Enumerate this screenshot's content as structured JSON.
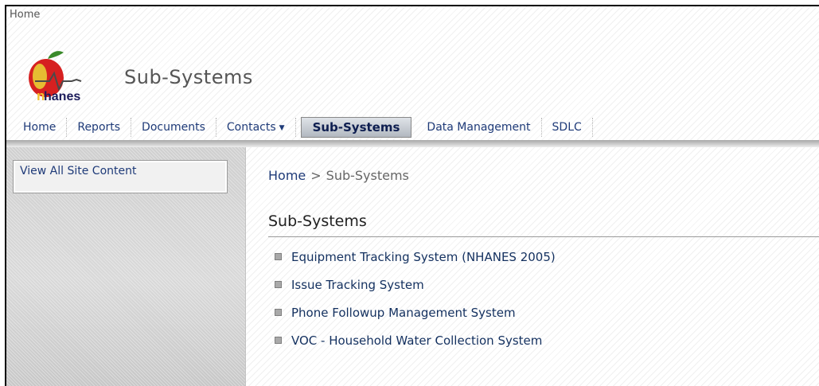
{
  "top_breadcrumb": "Home",
  "logo": {
    "text": "hanes",
    "first_letter": "n"
  },
  "site_title": "Sub-Systems",
  "topnav": [
    {
      "label": "Home",
      "active": false
    },
    {
      "label": "Reports",
      "active": false
    },
    {
      "label": "Documents",
      "active": false
    },
    {
      "label": "Contacts",
      "active": false,
      "dropdown": true
    },
    {
      "label": "Sub-Systems",
      "active": true
    },
    {
      "label": "Data Management",
      "active": false
    },
    {
      "label": "SDLC",
      "active": false
    }
  ],
  "sidebar": {
    "view_all_label": "View All Site Content"
  },
  "breadcrumb": {
    "home": "Home",
    "separator": ">",
    "current": "Sub-Systems"
  },
  "page_heading": "Sub-Systems",
  "items": [
    "Equipment Tracking System (NHANES 2005)",
    "Issue Tracking System",
    "Phone Followup Management System",
    "VOC - Household Water Collection System"
  ],
  "colors": {
    "link": "#1e3a78",
    "active_tab_bg": "#b2b8c0",
    "sidebar_bg": "#d6d6d6",
    "logo_apple": "#d62020",
    "logo_leaf": "#3a8a2a"
  },
  "icons": {
    "nav_dropdown": "chevron-down-icon",
    "list_bullet": "square-bullet-icon"
  }
}
